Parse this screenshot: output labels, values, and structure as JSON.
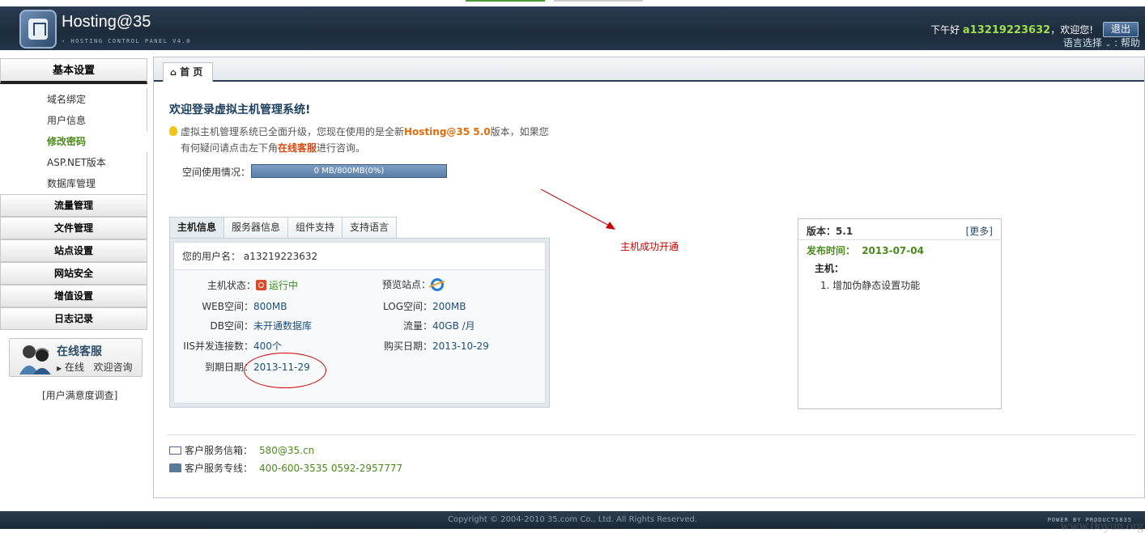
{
  "header": {
    "brand": "Hosting@35",
    "subtitle": "› HOSTING CONTROL PANEL V4.0",
    "greeting_prefix": "下午好",
    "username": "a13219223632",
    "greeting_suffix": "，欢迎您!",
    "logout": "退出",
    "language": "语言选择",
    "help": "帮助"
  },
  "sidebar": {
    "basic": "基本设置",
    "items": [
      {
        "label": "域名绑定"
      },
      {
        "label": "用户信息"
      },
      {
        "label": "修改密码",
        "active": true
      },
      {
        "label": "ASP.NET版本"
      },
      {
        "label": "数据库管理"
      }
    ],
    "groups": [
      "流量管理",
      "文件管理",
      "站点设置",
      "网站安全",
      "增值设置",
      "日志记录"
    ],
    "service_title": "在线客服",
    "service_status": "在线",
    "service_welcome": "欢迎咨询",
    "survey": "[用户满意度调查]"
  },
  "main": {
    "tab_home": "首 页",
    "welcome": "欢迎登录虚拟主机管理系统!",
    "notice_a": "虚拟主机管理系统已全面升级，您现在使用的是全新",
    "notice_brand": "Hosting@35 5.0",
    "notice_b": "版本，如果您",
    "notice_c": "有何疑问请点击左下角",
    "notice_link": "在线客服",
    "notice_d": "进行咨询。",
    "space_label": "空间使用情况：",
    "space_value": "0 MB/800MB(0%)",
    "annotation": "主机成功开通"
  },
  "info": {
    "tabs": [
      "主机信息",
      "服务器信息",
      "组件支持",
      "支持语言"
    ],
    "username_label": "您的用户名：",
    "username_value": "a13219223632",
    "host_status_label": "主机状态：",
    "host_status_value": "运行中",
    "preview_label": "预览站点：",
    "web_label": "WEB空间：",
    "web_value": "800MB",
    "log_label": "LOG空间：",
    "log_value": "200MB",
    "db_label": "DB空间：",
    "db_value": "未开通数据库",
    "traffic_label": "流量：",
    "traffic_value": "40GB /月",
    "iis_label": "IIS并发连接数：",
    "iis_value": "400个",
    "buy_label": "购买日期：",
    "buy_value": "2013-10-29",
    "expire_label": "到期日期：",
    "expire_value": "2013-11-29"
  },
  "version": {
    "title": "版本：5.1",
    "more": "[更多]",
    "date_label": "发布时间：",
    "date_value": "2013-07-04",
    "host_label": "主机：",
    "item": "1.   增加伪静态设置功能"
  },
  "contact": {
    "mail_label": "客户服务信箱：",
    "mail_value": "580@35.cn",
    "phone_label": "客户服务专线：",
    "phone_value": "400-600-3535 0592-2957777"
  },
  "footer": {
    "copyright": "Copyright © 2004-2010 35.com Co., Ltd. All Rights Reserved.",
    "powered": "POWER BY PRODUCTS835",
    "watermark": "www.0oyun.org"
  }
}
